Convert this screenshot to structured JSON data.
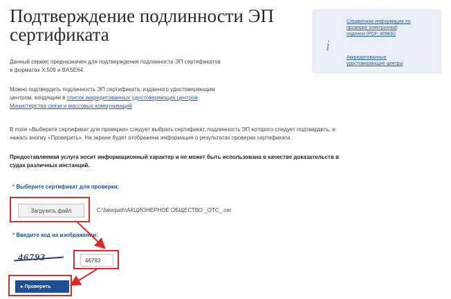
{
  "page": {
    "title_line1": "Подтверждение подлинности ЭП",
    "title_line2": "сертификата",
    "intro_line1": "Данный сервис предназначен для подтверждения подлинности ЭП сертификатов",
    "intro_line2": "в форматах X.509 и BASE64.",
    "ca_line1": "Можно подтвердить подлинность ЭП сертификата, изданного удостоверяющим",
    "ca_line2_prefix": "центром, входящим в ",
    "ca_link_part1": "список аккредитованных удостоверяющих центров",
    "ca_link_part2": "Министерства связи и массовых коммуникаций",
    "instr_line1": "В поле «Выберите сертификат для проверки» следует выбрать сертификат, подлинность ЭП которого следует подтвердить, и",
    "instr_line2": "нажать кнопку «Проверить». На экране будет отображена информация о результатах проверки сертификата.",
    "note_line1": "Предоставляемая услуга носит информационный характер и не может быть использована в качестве доказательств в",
    "note_line2": "судах различных инстанций."
  },
  "sidebar": {
    "link1_line1": "Справочная информация по",
    "link1_line2": "проверке электронной",
    "link1_line3": "подписи (PDF, 409КБ)",
    "link2_line1": "Аккредитованные",
    "link2_line2": "удостоверяющие центры"
  },
  "form": {
    "required_mark": "*",
    "cert_label": "Выберите сертификат для проверки:",
    "upload_button": "Загрузить файл",
    "file_path": "C:\\fakepath\\АКЦИОНЕРНОЕ ОБЩЕСТВО _ОТС_.cer",
    "captcha_label": "Введите код на изображении:",
    "captcha_image_text": "46793",
    "captcha_value": "46793",
    "check_button": "▸ Проверить"
  },
  "colors": {
    "annotation_red": "#d82a2a",
    "button_blue": "#1f4e94",
    "link_blue": "#2a5b9e"
  }
}
